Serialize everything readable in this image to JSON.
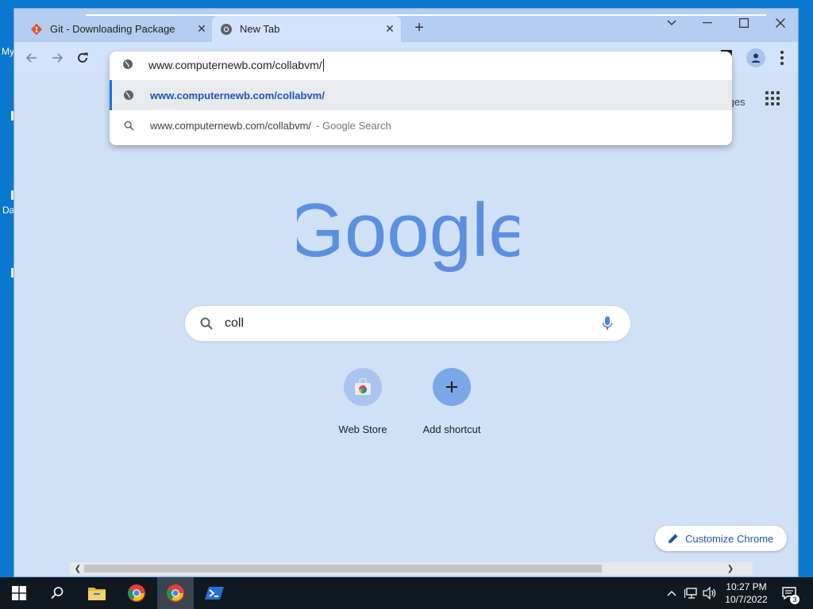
{
  "desktop": {
    "labels": [
      "My",
      "Da"
    ]
  },
  "browser": {
    "tabs": [
      {
        "title": "Git - Downloading Package",
        "icon": "git-icon",
        "active": false
      },
      {
        "title": "New Tab",
        "icon": "chrome-icon",
        "active": true
      }
    ],
    "omnibox": {
      "typed_text": "www.computernewb.com/collabvm/",
      "suggestions": [
        {
          "text": "www.computernewb.com/collabvm/",
          "suffix": "",
          "icon": "globe-icon",
          "selected": true
        },
        {
          "text": "www.computernewb.com/collabvm/",
          "suffix": "- Google Search",
          "icon": "search-icon",
          "selected": false
        }
      ]
    }
  },
  "newtab": {
    "images_link": "Images",
    "logo_text": "Google",
    "search_query": "coll",
    "shortcuts": [
      {
        "label": "Web Store",
        "icon": "web-store-icon"
      },
      {
        "label": "Add shortcut",
        "icon": "plus-icon"
      }
    ],
    "customize_label": "Customize Chrome"
  },
  "taskbar": {
    "time": "10:27 PM",
    "date": "10/7/2022",
    "notification_count": "3"
  },
  "colors": {
    "desktop_bg": "#0b78d0",
    "tabstrip_bg": "#b4cdf0",
    "page_bg": "#cfe0f7",
    "accent": "#1a73e8",
    "google_blue_tint": "#5b8fe0"
  }
}
